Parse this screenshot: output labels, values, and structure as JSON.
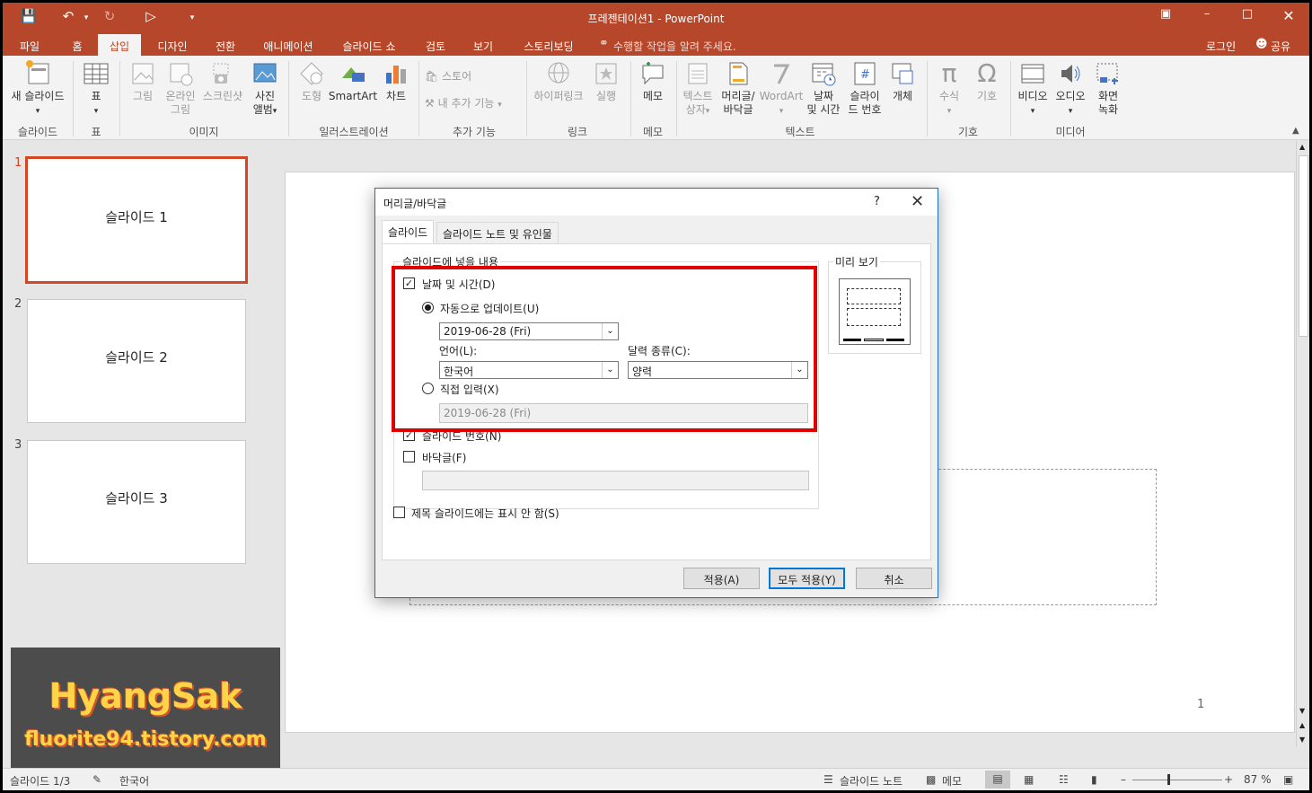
{
  "title": "프레젠테이션1 - PowerPoint",
  "tabs": [
    "파일",
    "홈",
    "삽입",
    "디자인",
    "전환",
    "애니메이션",
    "슬라이드 쇼",
    "검토",
    "보기",
    "스토리보딩"
  ],
  "tell_me": "수행할 작업을 알려 주세요.",
  "login": "로그인",
  "share": "공유",
  "ribbon": {
    "new_slide": "새 슬라이드",
    "table": "표",
    "picture": "그림",
    "online_picture_1": "온라인",
    "online_picture_2": "그림",
    "screenshot": "스크린샷",
    "album_1": "사진",
    "album_2": "앨범",
    "shapes": "도형",
    "smartart": "SmartArt",
    "chart": "차트",
    "store": "스토어",
    "my_addins": "내 추가 기능",
    "hyperlink": "하이퍼링크",
    "action": "실행",
    "comment": "메모",
    "textbox_1": "텍스트",
    "textbox_2": "상자",
    "header_footer_1": "머리글/",
    "header_footer_2": "바닥글",
    "wordart": "WordArt",
    "datetime_1": "날짜",
    "datetime_2": "및 시간",
    "slidenum_1": "슬라이",
    "slidenum_2": "드 번호",
    "object": "개체",
    "equation": "수식",
    "symbol": "기호",
    "video": "비디오",
    "audio": "오디오",
    "screen_rec_1": "화면",
    "screen_rec_2": "녹화",
    "groups": {
      "slides": "슬라이드",
      "tables": "표",
      "images": "이미지",
      "illustrations": "일러스트레이션",
      "addins": "추가 기능",
      "links": "링크",
      "comments": "메모",
      "text": "텍스트",
      "symbols": "기호",
      "media": "미디어"
    }
  },
  "slides": [
    {
      "num": "1",
      "label": "슬라이드 1"
    },
    {
      "num": "2",
      "label": "슬라이드 2"
    },
    {
      "num": "3",
      "label": "슬라이드 3"
    }
  ],
  "slide_number_shown": "1",
  "dialog": {
    "title": "머리글/바닥글",
    "help": "?",
    "tab_slide": "슬라이드",
    "tab_notes": "슬라이드 노트 및 유인물",
    "group_label": "슬라이드에 넣을 내용",
    "datetime_label": "날짜 및 시간(D)",
    "datetime_checked": true,
    "auto_update_label": "자동으로 업데이트(U)",
    "auto_date_value": "2019-06-28 (Fri)",
    "language_label": "언어(L):",
    "language_value": "한국어",
    "calendar_label": "달력 종류(C):",
    "calendar_value": "양력",
    "fixed_label": "직접 입력(X)",
    "fixed_value": "2019-06-28 (Fri)",
    "slide_number_label": "슬라이드 번호(N)",
    "slide_number_checked": true,
    "footer_label": "바닥글(F)",
    "footer_checked": false,
    "footer_value": "",
    "dont_show_title_label": "제목 슬라이드에는 표시 안 함(S)",
    "preview_label": "미리 보기",
    "apply": "적용(A)",
    "apply_all": "모두 적용(Y)",
    "cancel": "취소"
  },
  "status": {
    "slide_count": "슬라이드 1/3",
    "language": "한국어",
    "notes": "슬라이드 노트",
    "comments": "메모",
    "zoom": "87 %"
  },
  "watermark": {
    "name": "HyangSak",
    "site": "fluorite94.tistory.com"
  },
  "colors": {
    "accent": "#b7472a",
    "selected_thumb": "#d24726",
    "highlight_box": "#e00000"
  }
}
